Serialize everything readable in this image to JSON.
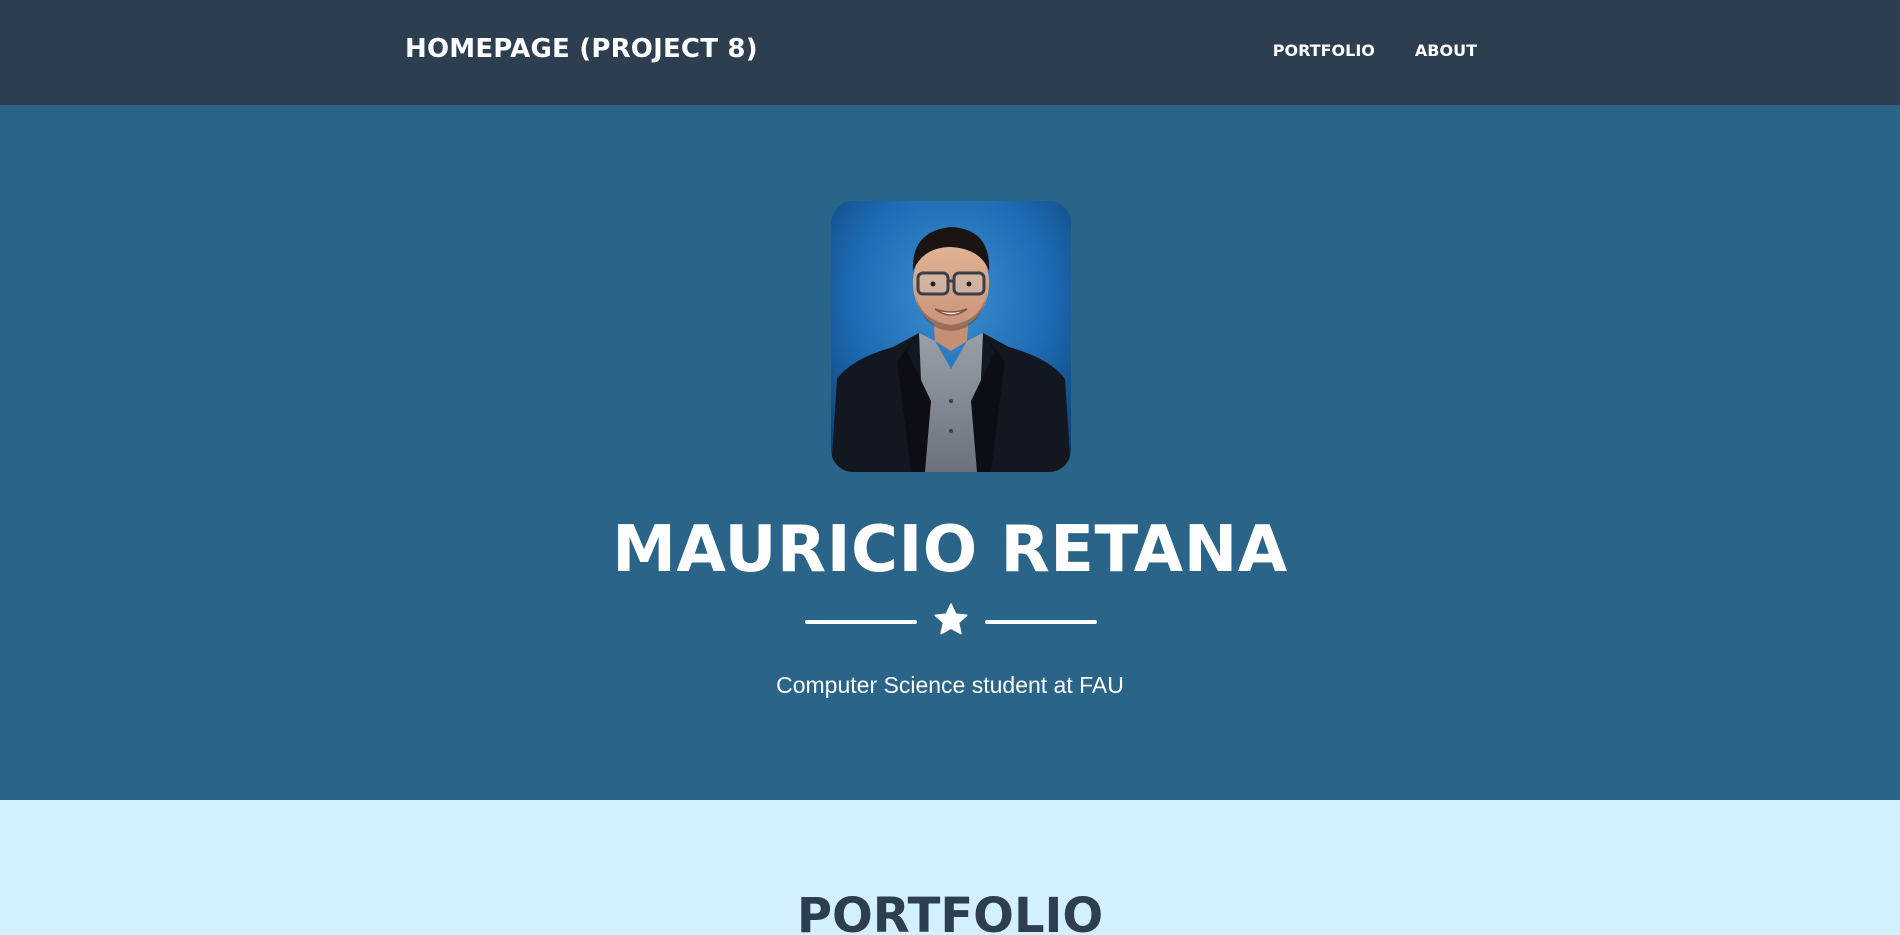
{
  "navbar": {
    "brand": "HOMEPAGE (PROJECT 8)",
    "links": [
      {
        "label": "PORTFOLIO"
      },
      {
        "label": "ABOUT"
      }
    ]
  },
  "masthead": {
    "heading": "MAURICIO RETANA",
    "subheading": "Computer Science student at FAU",
    "divider_icon": "star-icon"
  },
  "portfolio": {
    "heading": "PORTFOLIO"
  },
  "colors": {
    "navbar_bg": "#2c3e50",
    "masthead_bg": "#2a6589",
    "portfolio_bg": "#d3f0fe",
    "heading_dark": "#2c3e50",
    "text_light": "#ffffff"
  }
}
